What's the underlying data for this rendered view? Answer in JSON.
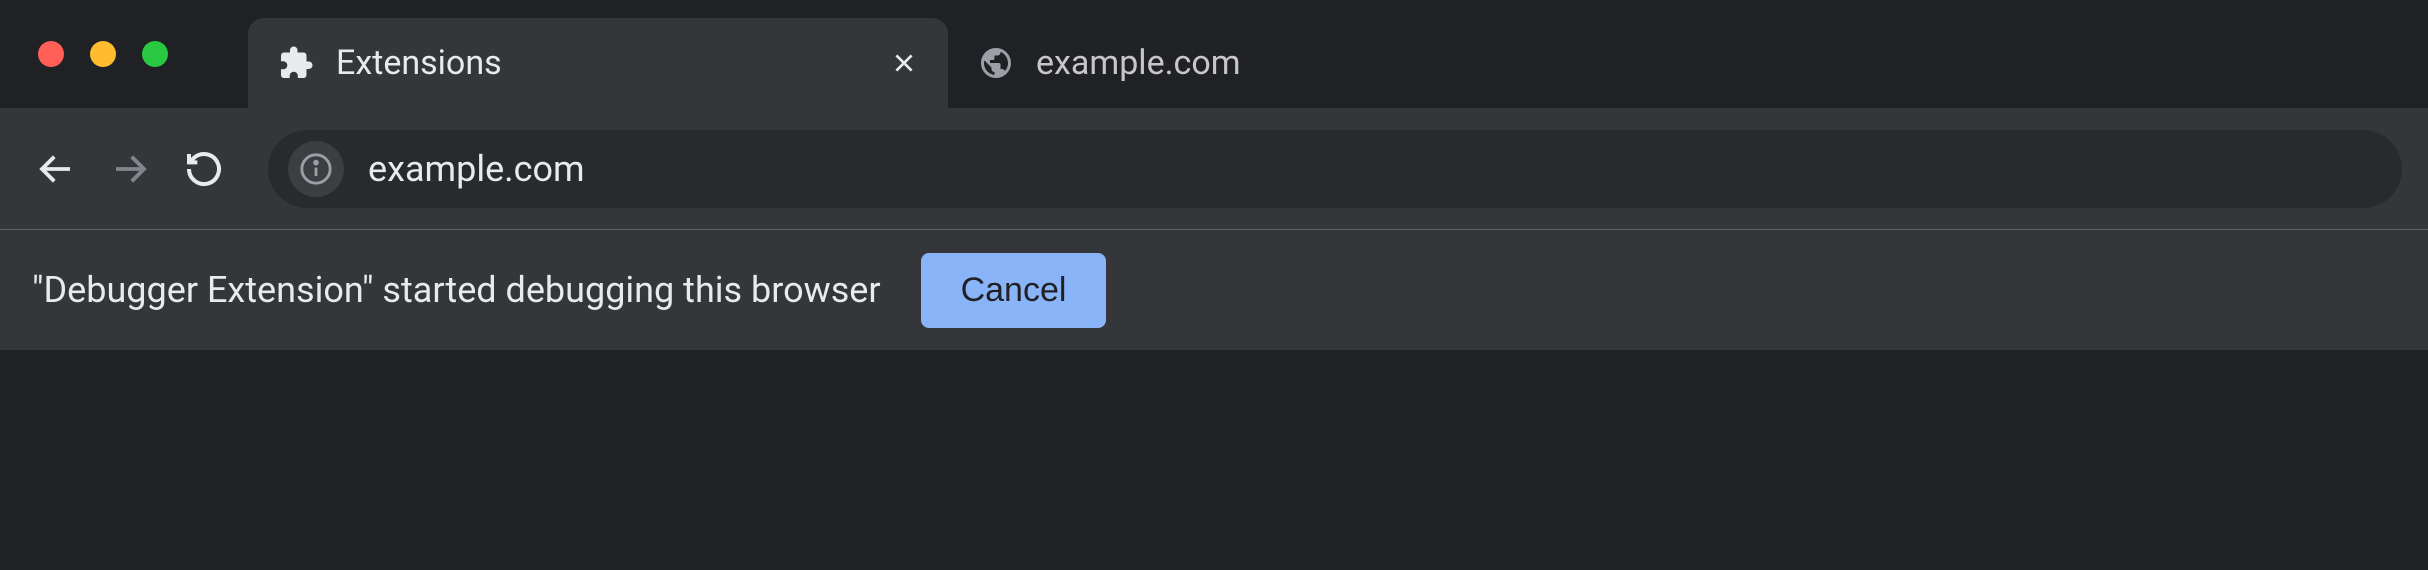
{
  "traffic_lights": {
    "close": "#ff5f57",
    "minimize": "#febc2e",
    "maximize": "#28c840"
  },
  "tabs": [
    {
      "title": "Extensions",
      "icon": "extension",
      "active": true
    },
    {
      "title": "example.com",
      "icon": "globe",
      "active": false
    }
  ],
  "toolbar": {
    "back_enabled": true,
    "forward_enabled": false,
    "reload_enabled": true
  },
  "omnibox": {
    "url": "example.com"
  },
  "infobar": {
    "message": "\"Debugger Extension\" started debugging this browser",
    "cancel_label": "Cancel"
  }
}
